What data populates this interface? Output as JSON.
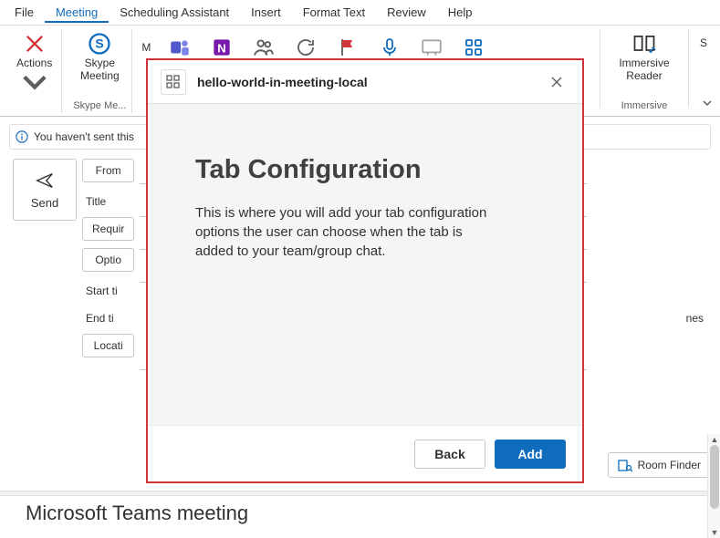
{
  "menubar": {
    "items": [
      "File",
      "Meeting",
      "Scheduling Assistant",
      "Insert",
      "Format Text",
      "Review",
      "Help"
    ],
    "active_index": 1
  },
  "ribbon": {
    "actions": {
      "label": "Actions"
    },
    "skype": {
      "label": "Skype Meeting",
      "group_label": "Skype Me..."
    },
    "immersive": {
      "label": "Immersive Reader",
      "group_label": "Immersive"
    },
    "s_overflow": "S"
  },
  "infobar": {
    "text": "You haven't sent this"
  },
  "form": {
    "send": "Send",
    "from": "From",
    "title": "Title",
    "required": "Requir",
    "optional": "Optio",
    "start": "Start ti",
    "end": "End ti",
    "location": "Locati",
    "time_zones": "nes",
    "room_finder": "Room Finder"
  },
  "body": {
    "heading": "Microsoft Teams meeting"
  },
  "modal": {
    "app_name": "hello-world-in-meeting-local",
    "heading": "Tab Configuration",
    "description": "This is where you will add your tab configuration options the user can choose when the tab is added to your team/group chat.",
    "back": "Back",
    "add": "Add"
  }
}
